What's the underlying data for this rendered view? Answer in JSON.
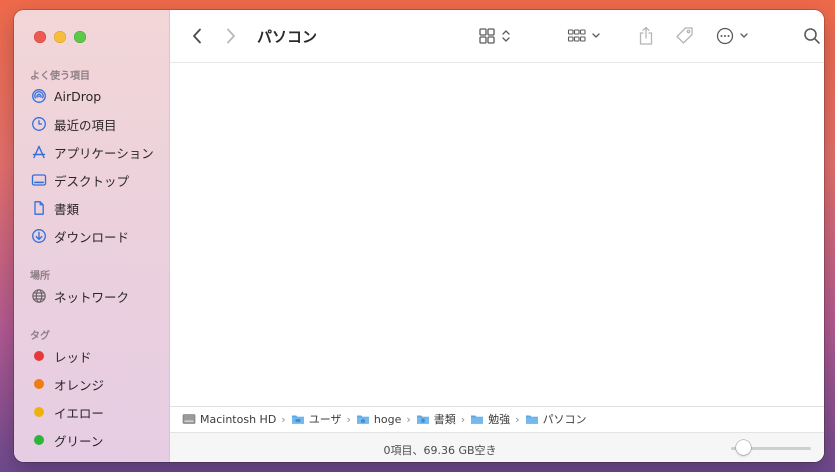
{
  "window": {
    "title": "パソコン"
  },
  "sidebar": {
    "favorites_label": "よく使う項目",
    "favorites": [
      {
        "label": "AirDrop",
        "icon": "airdrop-icon"
      },
      {
        "label": "最近の項目",
        "icon": "clock-icon"
      },
      {
        "label": "アプリケーション",
        "icon": "applications-icon"
      },
      {
        "label": "デスクトップ",
        "icon": "desktop-icon"
      },
      {
        "label": "書類",
        "icon": "document-icon"
      },
      {
        "label": "ダウンロード",
        "icon": "download-icon"
      }
    ],
    "locations_label": "場所",
    "locations": [
      {
        "label": "ネットワーク",
        "icon": "globe-icon"
      }
    ],
    "tags_label": "タグ",
    "tags": [
      {
        "label": "レッド",
        "color": "#e8393a"
      },
      {
        "label": "オレンジ",
        "color": "#ef7c14"
      },
      {
        "label": "イエロー",
        "color": "#efb20a"
      },
      {
        "label": "グリーン",
        "color": "#2fb43a"
      }
    ]
  },
  "pathbar": {
    "crumbs": [
      {
        "label": "Macintosh HD",
        "icon": "hard-drive-icon"
      },
      {
        "label": "ユーザ",
        "icon": "folder-icon"
      },
      {
        "label": "hoge",
        "icon": "home-folder-icon"
      },
      {
        "label": "書類",
        "icon": "folder-icon"
      },
      {
        "label": "勉強",
        "icon": "folder-icon"
      },
      {
        "label": "パソコン",
        "icon": "folder-icon"
      }
    ],
    "separator": "›"
  },
  "status": {
    "text": "0項目、69.36 GB空き",
    "zoom_level": 0.15
  },
  "colors": {
    "accent": "#2f6fdc",
    "folder": "#5aa8e6"
  }
}
